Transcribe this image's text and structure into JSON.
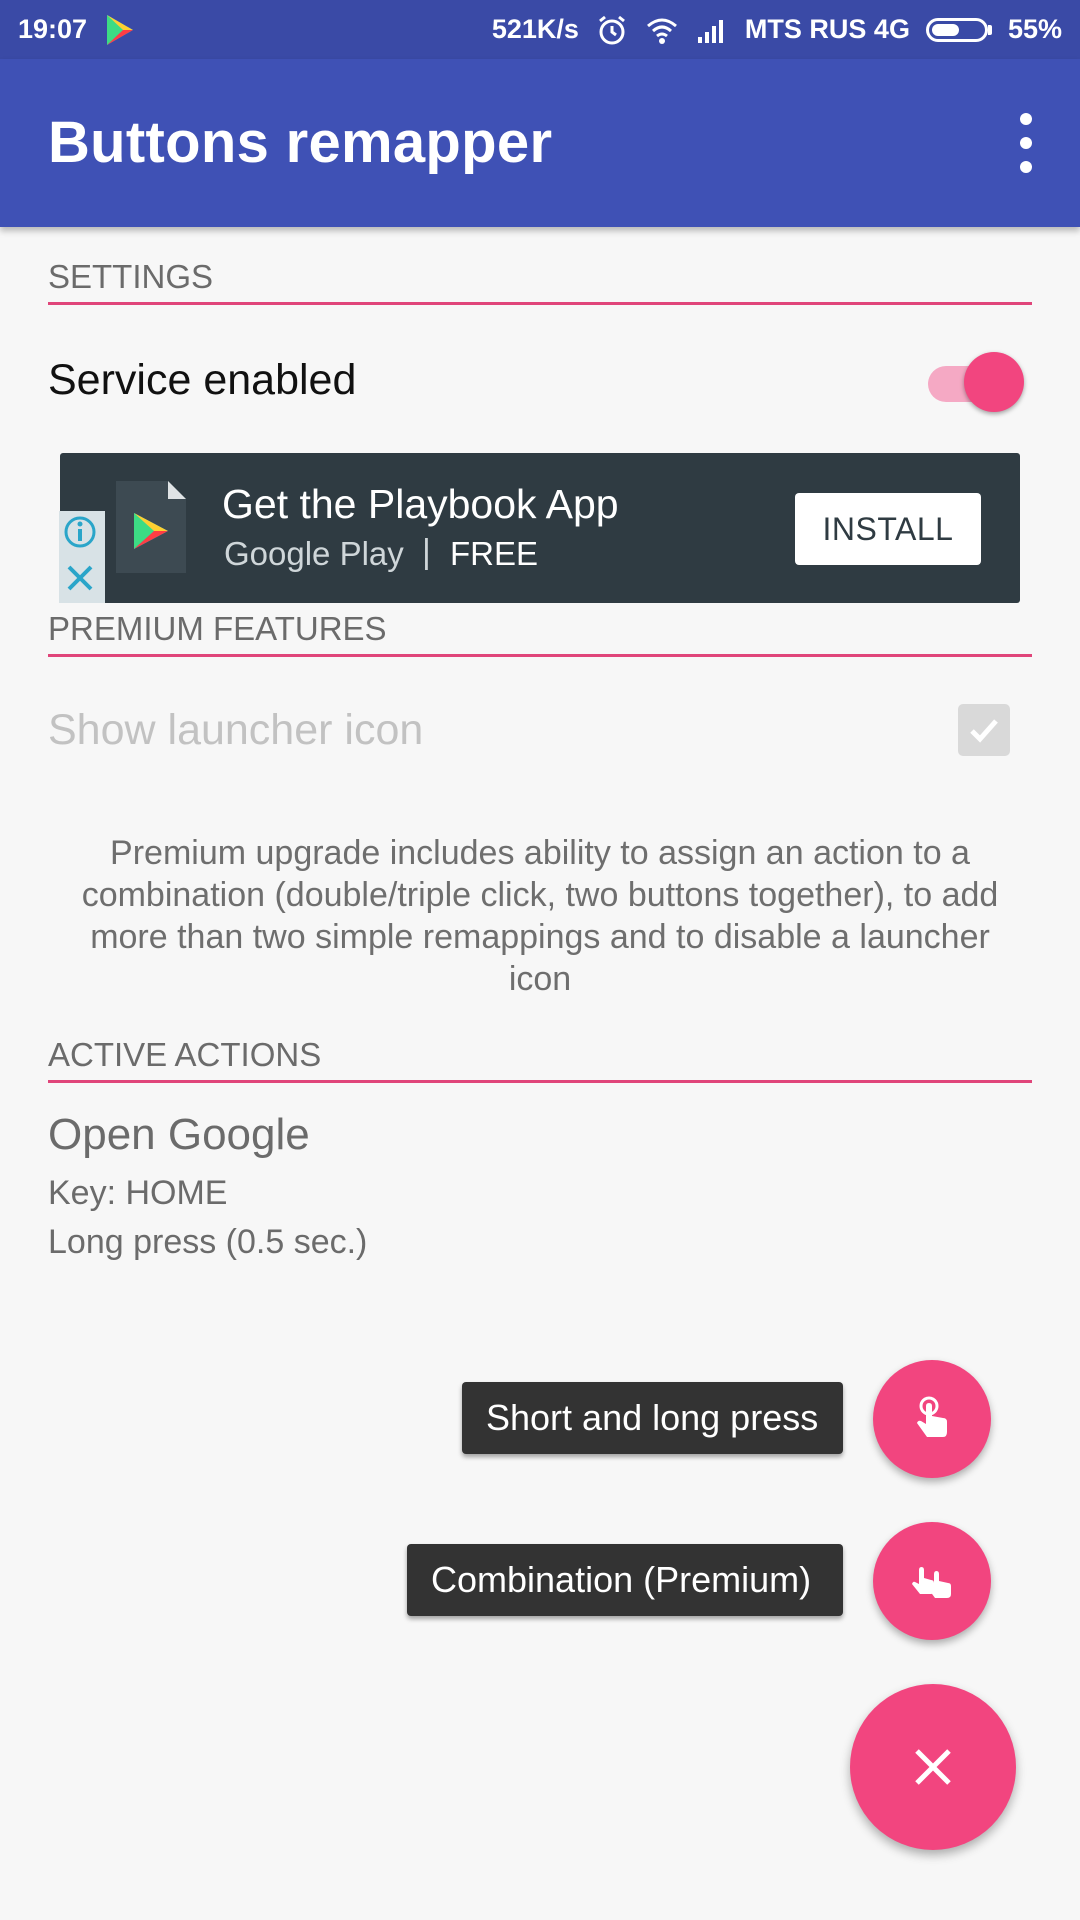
{
  "status_bar": {
    "time": "19:07",
    "speed": "521K/s",
    "carrier": "MTS RUS 4G",
    "battery": "55%",
    "battery_level": 0.55,
    "icons": [
      "play-store-icon",
      "alarm-icon",
      "wifi-icon",
      "signal-icon",
      "battery-icon"
    ]
  },
  "app_bar": {
    "title": "Buttons remapper",
    "menu_icon": "overflow-menu-icon",
    "color": "#3f51b5"
  },
  "settings": {
    "header": "SETTINGS",
    "service_label": "Service enabled",
    "service_enabled": true
  },
  "ad": {
    "title": "Get the Playbook App",
    "store": "Google Play",
    "separator": "|",
    "price": "FREE",
    "install_label": "INSTALL"
  },
  "premium": {
    "header": "PREMIUM FEATURES",
    "launcher_label": "Show launcher icon",
    "launcher_checked": true,
    "description": "Premium upgrade includes ability to assign an action to a combination (double/triple click, two buttons together), to add more than two simple remappings and to disable a launcher icon"
  },
  "active_actions": {
    "header": "ACTIVE ACTIONS",
    "items": [
      {
        "title": "Open Google",
        "key": "Key: HOME",
        "press": "Long press (0.5 sec.)"
      }
    ]
  },
  "fab_menu": {
    "short_long_label": "Short and long press",
    "combination_label": "Combination (Premium)",
    "accent_color": "#f2457f"
  }
}
